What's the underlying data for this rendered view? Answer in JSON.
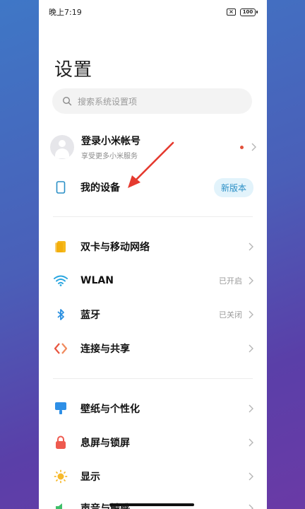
{
  "status": {
    "time": "晚上7:19",
    "battery": "100"
  },
  "title": "设置",
  "search": {
    "placeholder": "搜索系统设置项"
  },
  "account": {
    "title": "登录小米帐号",
    "subtitle": "享受更多小米服务"
  },
  "device": {
    "label": "我的设备",
    "badge": "新版本"
  },
  "network_group": [
    {
      "label": "双卡与移动网络",
      "value": ""
    },
    {
      "label": "WLAN",
      "value": "已开启"
    },
    {
      "label": "蓝牙",
      "value": "已关闭"
    },
    {
      "label": "连接与共享",
      "value": ""
    }
  ],
  "display_group": [
    {
      "label": "壁纸与个性化",
      "value": ""
    },
    {
      "label": "息屏与锁屏",
      "value": ""
    },
    {
      "label": "显示",
      "value": ""
    },
    {
      "label": "声音与触感",
      "value": ""
    }
  ],
  "colors": {
    "accent_blue": "#2a8fc6",
    "sim_yellow": "#f5b91e",
    "wlan_blue": "#2aa6e0",
    "bluetooth_blue": "#2a8fe0",
    "share_red": "#e8553f",
    "wallpaper_blue": "#2e8fe6",
    "lock_red": "#ee5a4f",
    "display_yellow": "#f6b92b",
    "arrow_red": "#e53a2f"
  }
}
